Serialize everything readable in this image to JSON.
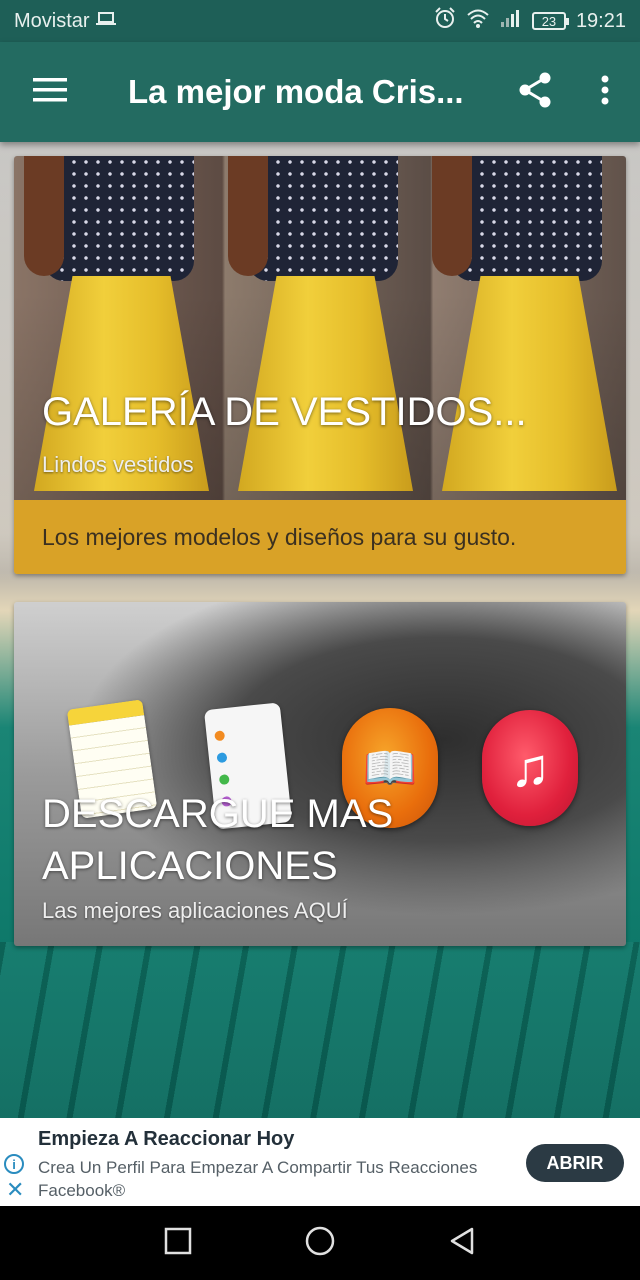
{
  "status_bar": {
    "carrier": "Movistar",
    "battery": "23",
    "time": "19:21"
  },
  "app_bar": {
    "title": "La mejor moda Cris..."
  },
  "cards": [
    {
      "title": "GALERÍA DE VESTIDOS...",
      "subtitle": "Lindos vestidos",
      "band_text": "Los mejores modelos y diseños para su gusto."
    },
    {
      "title": "DESCARGUE MAS APLICACIONES",
      "subtitle": "Las mejores aplicaciones AQUÍ"
    }
  ],
  "ad": {
    "title": "Empieza A Reaccionar Hoy",
    "description": "Crea Un Perfil Para Empezar A Compartir Tus Reacciones Facebook®",
    "button": "ABRIR",
    "info_glyph": "i",
    "close_glyph": "✕"
  },
  "colors": {
    "primary": "#236b61",
    "status_bar": "#1e5f57",
    "accent_band": "#d9a227",
    "ad_button": "#2b3a44"
  },
  "icons": [
    "menu-icon",
    "share-icon",
    "more-vert-icon",
    "alarm-icon",
    "wifi-icon",
    "signal-icon",
    "battery-icon",
    "laptop-icon",
    "recent-apps-icon",
    "home-icon",
    "back-icon",
    "info-icon",
    "close-icon"
  ]
}
